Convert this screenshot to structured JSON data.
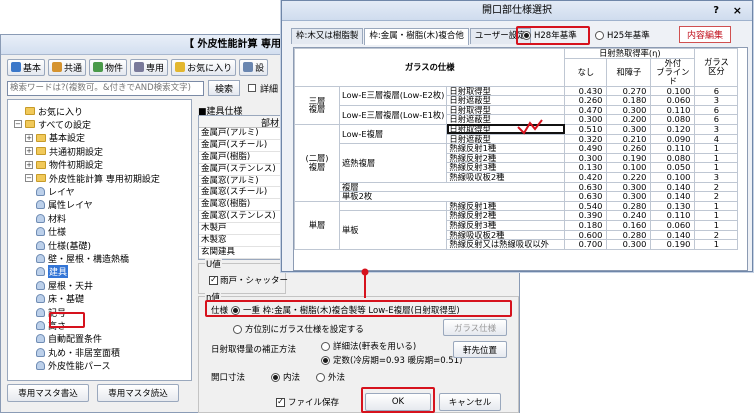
{
  "main_window": {
    "title": "【 外皮性能計算 専用",
    "toolbar": [
      {
        "label": "基本",
        "icon": "home-icon",
        "color": "#3b78c9"
      },
      {
        "label": "共通",
        "icon": "people-icon",
        "color": "#d5932f"
      },
      {
        "label": "物件",
        "icon": "house-icon",
        "color": "#4a9a4a"
      },
      {
        "label": "専用",
        "icon": "pc-icon",
        "color": "#7a7a9a"
      },
      {
        "label": "お気に入り",
        "icon": "star-icon",
        "color": "#e3b72f"
      },
      {
        "label": "設",
        "icon": "gear-icon",
        "color": "#6a86b0"
      }
    ],
    "search": {
      "placeholder": "検索ワードは?(複数可。&付きでAND検索文字)",
      "button": "検索",
      "detail_label": "詳細"
    },
    "tree": [
      {
        "label": "お気に入り",
        "level": 0,
        "kind": "folder",
        "exp": ""
      },
      {
        "label": "すべての設定",
        "level": 0,
        "kind": "folder",
        "exp": "−"
      },
      {
        "label": "基本設定",
        "level": 1,
        "kind": "folder",
        "exp": "+"
      },
      {
        "label": "共通初期設定",
        "level": 1,
        "kind": "folder",
        "exp": "+"
      },
      {
        "label": "物件初期設定",
        "level": 1,
        "kind": "folder",
        "exp": "+"
      },
      {
        "label": "外皮性能計算 専用初期設定",
        "level": 1,
        "kind": "folder",
        "exp": "−"
      },
      {
        "label": "レイヤ",
        "level": 2,
        "kind": "leaf"
      },
      {
        "label": "属性レイヤ",
        "level": 2,
        "kind": "leaf"
      },
      {
        "label": "材料",
        "level": 2,
        "kind": "leaf"
      },
      {
        "label": "仕様",
        "level": 2,
        "kind": "leaf"
      },
      {
        "label": "仕様(基礎)",
        "level": 2,
        "kind": "leaf"
      },
      {
        "label": "壁・屋根・構造熱橋",
        "level": 2,
        "kind": "leaf"
      },
      {
        "label": "建具",
        "level": 2,
        "kind": "leaf",
        "selected": true
      },
      {
        "label": "屋根・天井",
        "level": 2,
        "kind": "leaf"
      },
      {
        "label": "床・基礎",
        "level": 2,
        "kind": "leaf"
      },
      {
        "label": "記号",
        "level": 2,
        "kind": "leaf"
      },
      {
        "label": "高さ",
        "level": 2,
        "kind": "leaf"
      },
      {
        "label": "自動配置条件",
        "level": 2,
        "kind": "leaf"
      },
      {
        "label": "丸め・非居室面積",
        "level": 2,
        "kind": "leaf"
      },
      {
        "label": "外皮性能パース",
        "level": 2,
        "kind": "leaf"
      }
    ],
    "spec_section_label": "■建具仕様",
    "spec_header": "部材",
    "spec_rows": [
      "金属戸(アルミ)",
      "金属戸(スチール)",
      "金属戸(樹脂)",
      "金属戸(ステンレス)",
      "金属窓(アルミ)",
      "金属窓(スチール)",
      "金属窓(樹脂)",
      "金属窓(ステンレス)",
      "木製戸",
      "木製窓",
      "玄関建具"
    ],
    "u_value": {
      "caption": "U値",
      "checkbox_label": "雨戸・シャッター"
    },
    "eta": {
      "caption": "η値",
      "spec_label": "仕様",
      "spec_value": "一重 枠:金属・樹脂(木)複合製等 Low-E複層(日射取得型)",
      "per_direction_label": "方位別にガラス仕様を設定する",
      "glass_spec_button": "ガラス仕様",
      "correction_label": "日射取得量の補正方法",
      "detail_condition": "詳細法(軒表を用いる)",
      "constant": "定数(冷房期=0.93 暖房期=0.51)",
      "eave_button": "軒先位置",
      "opening_label": "開口寸法",
      "inside": "内法",
      "outside": "外法"
    },
    "footer": {
      "master_write": "専用マスタ書込",
      "master_read": "専用マスタ読込",
      "save_file": "ファイル保存",
      "ok": "OK",
      "cancel": "キャンセル"
    }
  },
  "dialog": {
    "title": "開口部仕様選択",
    "help": "?",
    "close": "×",
    "tabs": [
      "枠:木又は樹脂製",
      "枠:金属・樹脂(木)複合他",
      "ユーザー設定"
    ],
    "standards": [
      "H28年基準",
      "H25年基準"
    ],
    "edit_button": "内容編集",
    "table_header": {
      "glass": "ガラスの仕様",
      "rate_group": "日射熱取得率(η)",
      "cols": [
        "なし",
        "和障子",
        "外付\nブラインド"
      ],
      "class": "ガラス\n区分"
    },
    "sections": [
      {
        "group": "三層\n複層",
        "rows": [
          {
            "name": "Low-E三層複層(Low-E2枚)",
            "sub": "日射取得型",
            "v": [
              "0.430",
              "0.270",
              "0.100"
            ],
            "k": "6"
          },
          {
            "name": "",
            "sub": "日射遮蔽型",
            "v": [
              "0.260",
              "0.180",
              "0.060"
            ],
            "k": "3"
          },
          {
            "name": "Low-E三層複層(Low-E1枚)",
            "sub": "日射取得型",
            "v": [
              "0.470",
              "0.300",
              "0.110"
            ],
            "k": "6"
          },
          {
            "name": "",
            "sub": "日射遮蔽型",
            "v": [
              "0.300",
              "0.200",
              "0.080"
            ],
            "k": "6"
          }
        ]
      },
      {
        "group": "(二層)\n複層",
        "rows": [
          {
            "name": "Low-E複層",
            "sub": "日射取得型",
            "v": [
              "0.510",
              "0.300",
              "0.120"
            ],
            "k": "3",
            "hl": true
          },
          {
            "name": "",
            "sub": "日射遮蔽型",
            "v": [
              "0.320",
              "0.210",
              "0.090"
            ],
            "k": "4"
          },
          {
            "name": "遮熱複層",
            "sub": "熱線反射1種",
            "v": [
              "0.490",
              "0.260",
              "0.110"
            ],
            "k": "1"
          },
          {
            "name": "",
            "sub": "熱線反射2種",
            "v": [
              "0.300",
              "0.190",
              "0.080"
            ],
            "k": "1"
          },
          {
            "name": "",
            "sub": "熱線反射3種",
            "v": [
              "0.130",
              "0.100",
              "0.050"
            ],
            "k": "1"
          },
          {
            "name": "",
            "sub": "熱線吸収板2種",
            "v": [
              "0.420",
              "0.220",
              "0.100"
            ],
            "k": "3"
          },
          {
            "name": "複層",
            "sub": "",
            "v": [
              "0.630",
              "0.300",
              "0.140"
            ],
            "k": "2"
          },
          {
            "name": "単板2枚",
            "sub": "",
            "v": [
              "0.630",
              "0.300",
              "0.140"
            ],
            "k": "2"
          }
        ]
      },
      {
        "group": "単層",
        "rows": [
          {
            "name": "",
            "sub": "熱線反射1種",
            "v": [
              "0.540",
              "0.280",
              "0.130"
            ],
            "k": "1"
          },
          {
            "name": "単板",
            "sub": "熱線反射2種",
            "v": [
              "0.390",
              "0.240",
              "0.110"
            ],
            "k": "1"
          },
          {
            "name": "",
            "sub": "熱線反射3種",
            "v": [
              "0.180",
              "0.160",
              "0.060"
            ],
            "k": "1"
          },
          {
            "name": "",
            "sub": "熱線吸収板2種",
            "v": [
              "0.600",
              "0.280",
              "0.140"
            ],
            "k": "2"
          },
          {
            "name": "",
            "sub": "熱線反射又は熱線吸収以外",
            "v": [
              "0.700",
              "0.300",
              "0.190"
            ],
            "k": "1"
          }
        ]
      }
    ]
  },
  "colors": {
    "highlight_red": "#d6121d",
    "selection_blue": "#3375d6"
  }
}
